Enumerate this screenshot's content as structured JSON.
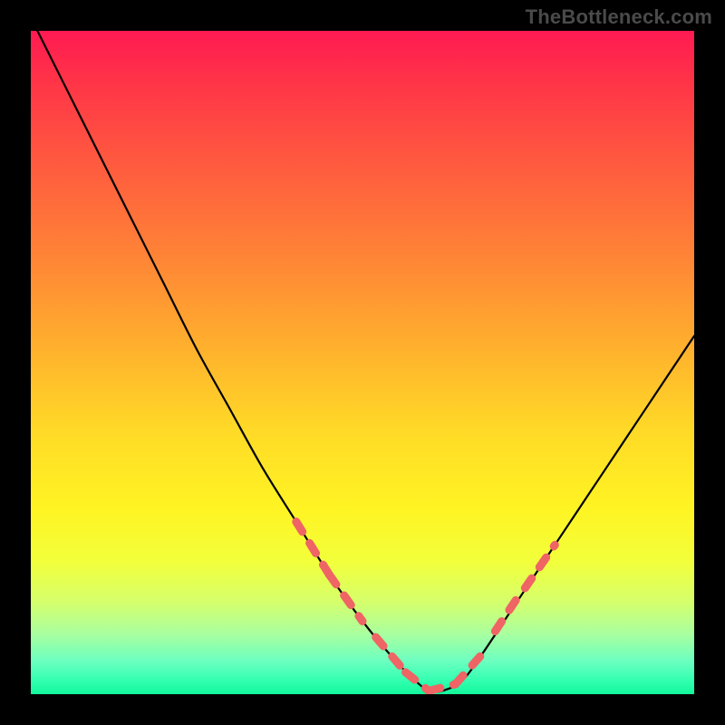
{
  "watermark": "TheBottleneck.com",
  "colors": {
    "page_bg": "#000000",
    "curve": "#000000",
    "highlight": "#ef6464",
    "gradient_top": "#ff1a52",
    "gradient_bottom": "#12f79a"
  },
  "chart_data": {
    "type": "line",
    "title": "",
    "xlabel": "",
    "ylabel": "",
    "xlim": [
      0,
      100
    ],
    "ylim": [
      0,
      100
    ],
    "series": [
      {
        "name": "bottleneck-curve",
        "x": [
          0,
          5,
          10,
          15,
          20,
          25,
          30,
          35,
          40,
          45,
          50,
          55,
          58,
          60,
          62,
          65,
          68,
          72,
          76,
          80,
          84,
          88,
          92,
          96,
          100
        ],
        "y": [
          102,
          92,
          82,
          72,
          62,
          52,
          43,
          34,
          26,
          18,
          11,
          5,
          2,
          0.5,
          0.5,
          2,
          6,
          12,
          18,
          24,
          30,
          36,
          42,
          48,
          54
        ]
      }
    ],
    "highlight_segments": [
      {
        "x": [
          40,
          45
        ],
        "y": [
          26,
          18
        ]
      },
      {
        "x": [
          45,
          50
        ],
        "y": [
          18,
          11
        ]
      },
      {
        "x": [
          52,
          56.5
        ],
        "y": [
          8.6,
          3.3
        ]
      },
      {
        "x": [
          56.5,
          60
        ],
        "y": [
          3.3,
          0.5
        ]
      },
      {
        "x": [
          60,
          64
        ],
        "y": [
          0.5,
          1.5
        ]
      },
      {
        "x": [
          64,
          68
        ],
        "y": [
          1.5,
          6
        ]
      },
      {
        "x": [
          70,
          74
        ],
        "y": [
          9.5,
          15.5
        ]
      },
      {
        "x": [
          74.5,
          79
        ],
        "y": [
          16,
          22.5
        ]
      }
    ]
  }
}
